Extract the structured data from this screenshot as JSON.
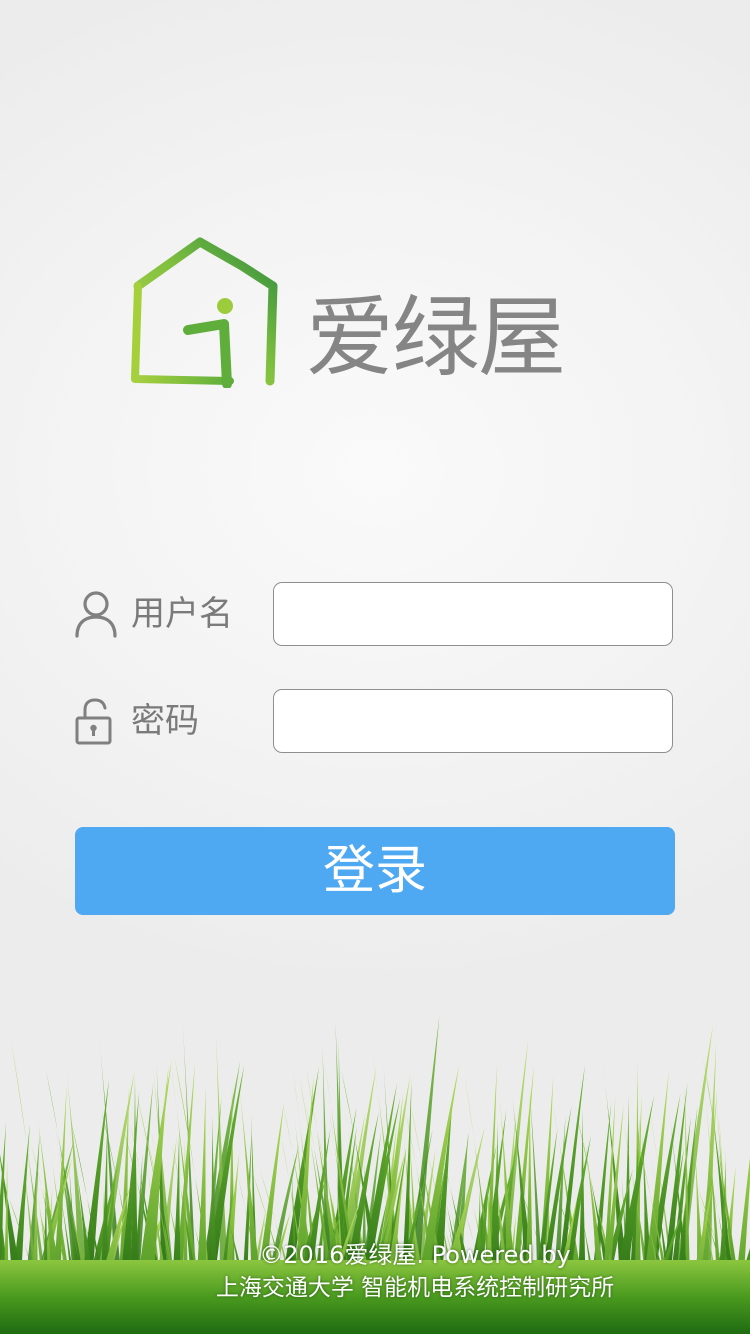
{
  "brand": {
    "name": "爱绿屋",
    "colors": {
      "logo_green_light": "#a6cf3c",
      "logo_green_dark": "#2e8b3e",
      "logo_text": "#858585"
    },
    "logo_icon": "house-i-icon"
  },
  "form": {
    "username": {
      "icon": "user-icon",
      "label": "用户名",
      "value": "",
      "placeholder": ""
    },
    "password": {
      "icon": "lock-icon",
      "label": "密码",
      "value": "",
      "placeholder": ""
    }
  },
  "login_button": {
    "label": "登录",
    "color": "#4ea8f2"
  },
  "footer": {
    "line1": "©2016爱绿屋. Powered by",
    "line2": "上海交通大学 智能机电系统控制研究所"
  }
}
